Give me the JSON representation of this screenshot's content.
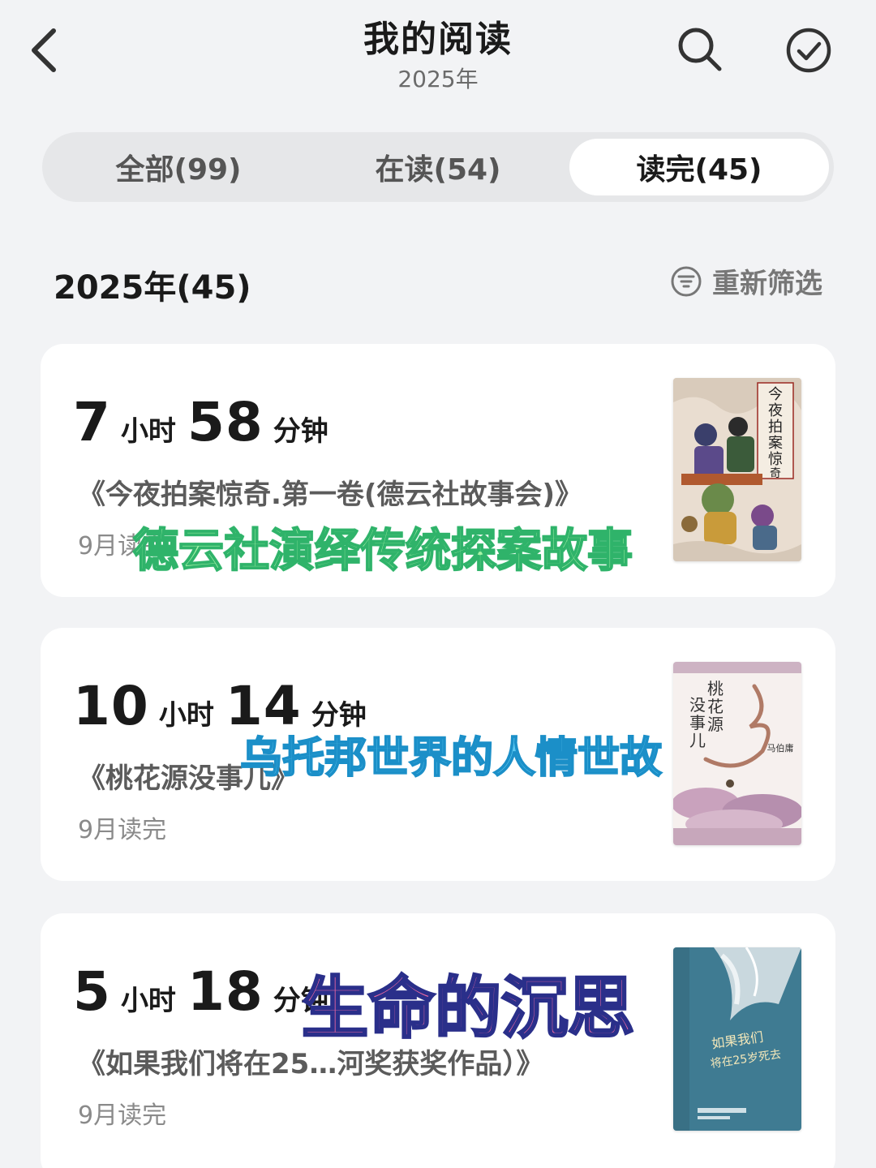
{
  "header": {
    "title": "我的阅读",
    "subtitle": "2025年",
    "icons": {
      "back": "chevron-left-icon",
      "search": "search-icon",
      "select": "check-circle-icon"
    }
  },
  "tabs": [
    {
      "label": "全部(99)",
      "selected": false
    },
    {
      "label": "在读(54)",
      "selected": false
    },
    {
      "label": "读完(45)",
      "selected": true
    }
  ],
  "section": {
    "year_label": "2025年(45)",
    "refilter_label": "重新筛选",
    "refilter_icon": "filter-circle-icon"
  },
  "books": [
    {
      "hours": "7",
      "hours_unit": "小时",
      "minutes": "58",
      "minutes_unit": "分钟",
      "title": "《今夜拍案惊奇.第一卷(德云社故事会)》",
      "finish": "9月读完",
      "cover_title": "今夜拍案惊奇"
    },
    {
      "hours": "10",
      "hours_unit": "小时",
      "minutes": "14",
      "minutes_unit": "分钟",
      "title": "《桃花源没事儿》",
      "finish": "9月读完",
      "cover_title": "桃花源没事儿",
      "cover_author": "马伯庸"
    },
    {
      "hours": "5",
      "hours_unit": "小时",
      "minutes": "18",
      "minutes_unit": "分钟",
      "title": "《如果我们将在25…河奖获奖作品）》",
      "finish": "9月读完",
      "cover_title": "如果我们将在25岁死去"
    }
  ],
  "overlays": {
    "caption1": "德云社演绎传统探案故事",
    "caption2": "乌托邦世界的人情世故",
    "caption3": "生命的沉思"
  },
  "colors": {
    "background": "#f2f3f5",
    "card": "#ffffff",
    "caption1": "#a6f3a6",
    "caption2": "#5bc7f0",
    "caption3": "#f26aa2"
  }
}
